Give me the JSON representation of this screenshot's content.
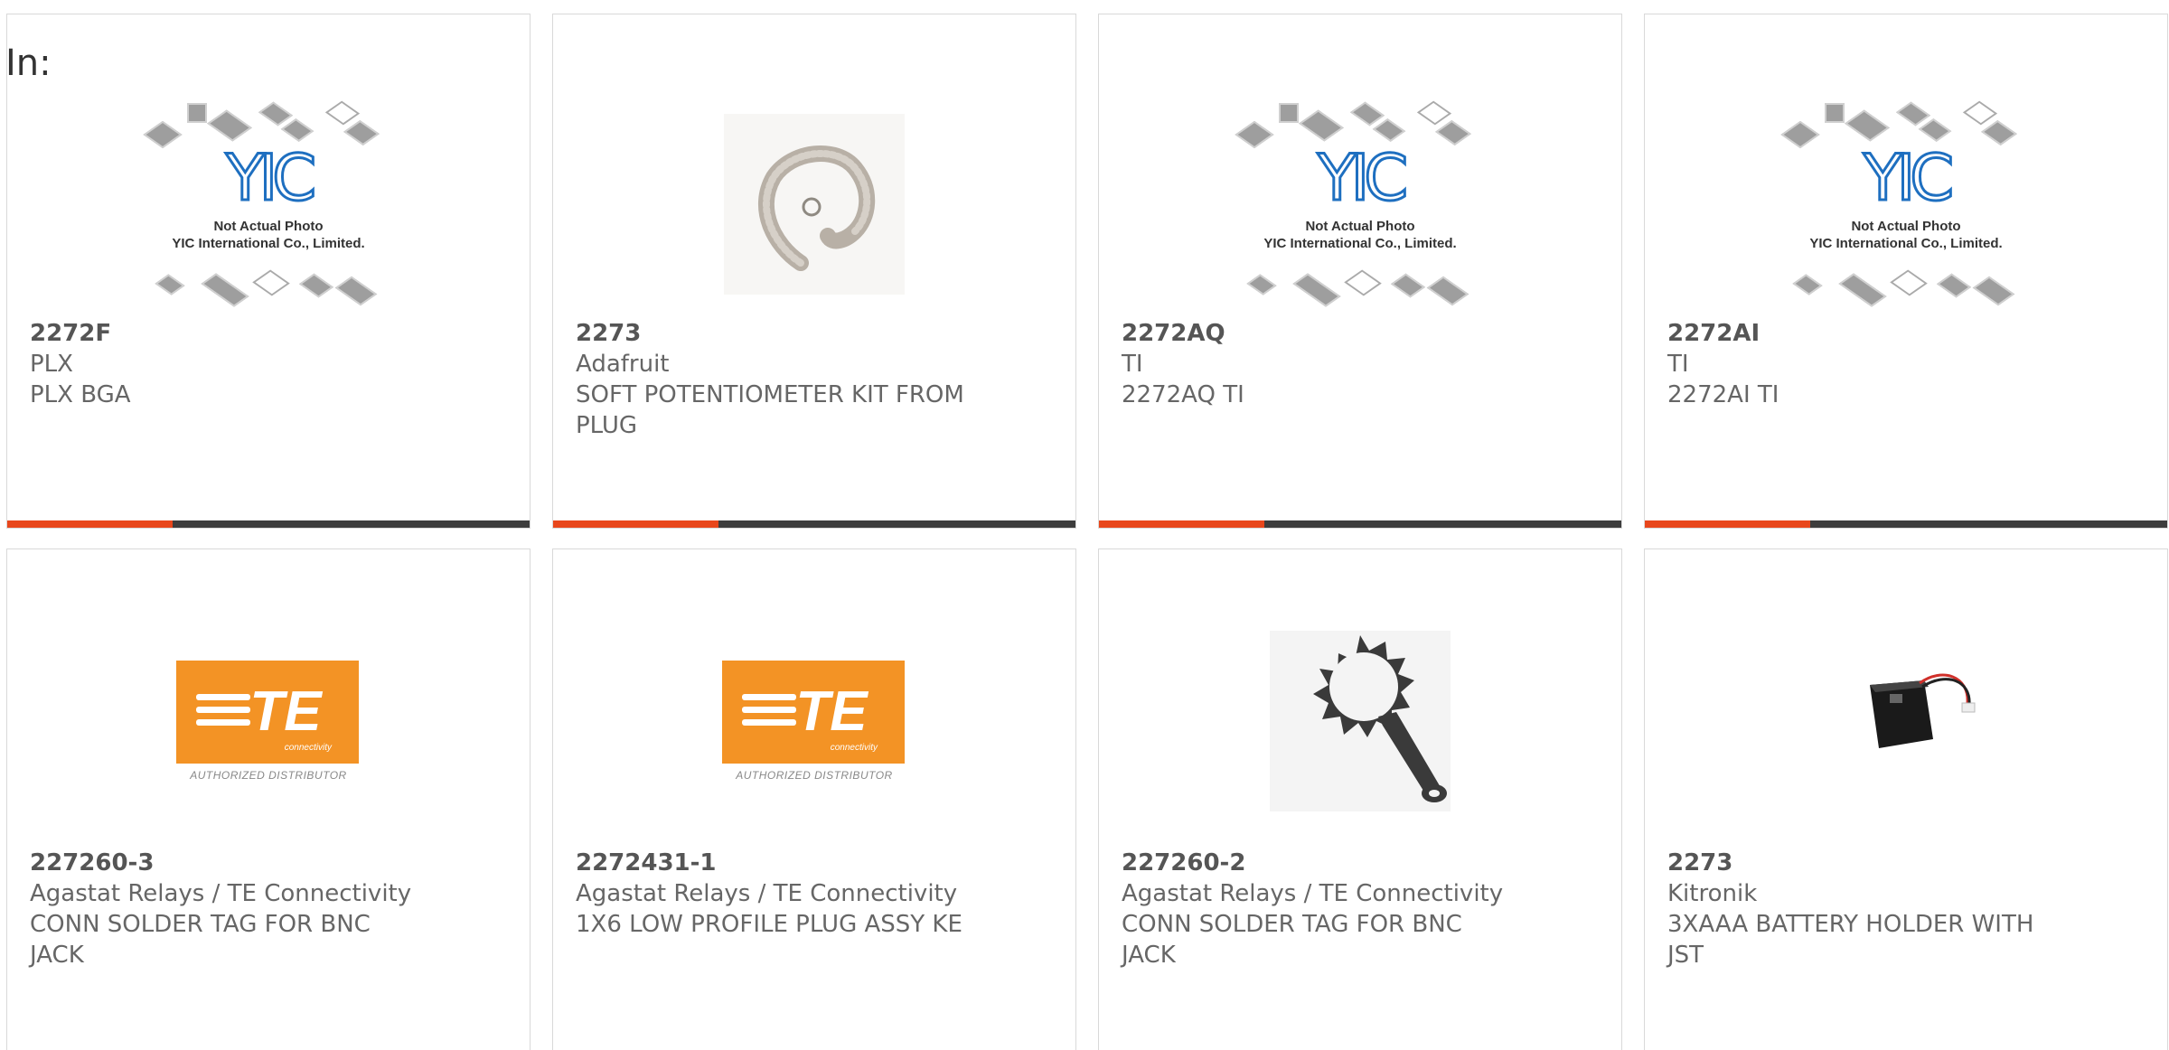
{
  "filter": {
    "label": "In:"
  },
  "products": [
    {
      "part": "2272F",
      "manufacturer": "PLX",
      "description": "PLX BGA",
      "image": "yic-placeholder",
      "image_caption": [
        "Not Actual Photo",
        "YIC International Co., Limited."
      ],
      "logo_text": "YIC"
    },
    {
      "part": "2273",
      "manufacturer": "Adafruit",
      "description": "SOFT POTENTIOMETER KIT FROM PLUG",
      "image": "soft-potentiometer-photo"
    },
    {
      "part": "2272AQ",
      "manufacturer": "TI",
      "description": "2272AQ TI",
      "image": "yic-placeholder",
      "image_caption": [
        "Not Actual Photo",
        "YIC International Co., Limited."
      ],
      "logo_text": "YIC"
    },
    {
      "part": "2272AI",
      "manufacturer": "TI",
      "description": "2272AI TI",
      "image": "yic-placeholder",
      "image_caption": [
        "Not Actual Photo",
        "YIC International Co., Limited."
      ],
      "logo_text": "YIC"
    },
    {
      "part": "227260-3",
      "manufacturer": "Agastat Relays / TE Connectivity",
      "description": "CONN SOLDER TAG FOR BNC JACK",
      "image": "te-logo",
      "logo_text": "TE",
      "logo_sub": "connectivity",
      "image_caption": [
        "AUTHORIZED DISTRIBUTOR"
      ]
    },
    {
      "part": "2272431-1",
      "manufacturer": "Agastat Relays / TE Connectivity",
      "description": "1X6 LOW PROFILE PLUG ASSY KE",
      "image": "te-logo",
      "logo_text": "TE",
      "logo_sub": "connectivity",
      "image_caption": [
        "AUTHORIZED DISTRIBUTOR"
      ]
    },
    {
      "part": "227260-2",
      "manufacturer": "Agastat Relays / TE Connectivity",
      "description": "CONN SOLDER TAG FOR BNC JACK",
      "image": "solder-tag-photo"
    },
    {
      "part": "2273",
      "manufacturer": "Kitronik",
      "description": "3XAAA BATTERY HOLDER WITH JST",
      "image": "battery-holder-photo"
    }
  ],
  "colors": {
    "accent": "#e8471c",
    "bar": "#3d3d3d",
    "te_orange": "#f39325",
    "yic_blue": "#1e6fc0"
  }
}
